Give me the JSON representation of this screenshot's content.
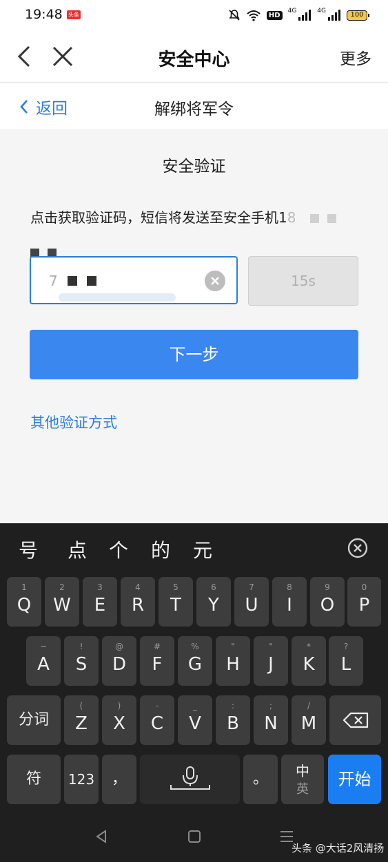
{
  "status_bar": {
    "time": "19:48",
    "app_badge": "头条",
    "hd_label": "HD",
    "network_labels": [
      "4G",
      "4G"
    ],
    "battery": "100"
  },
  "title_bar": {
    "title": "安全中心",
    "more_label": "更多"
  },
  "sub_nav": {
    "back_label": "返回",
    "title": "解绑将军令"
  },
  "verification": {
    "section_title": "安全验证",
    "instruction": "点击获取验证码，短信将发送至安全手机1",
    "instruction_suffix": "8",
    "code_value_visible": "7",
    "resend_label": "15s",
    "next_label": "下一步",
    "other_methods_label": "其他验证方式"
  },
  "keyboard": {
    "candidates": [
      "号",
      "点",
      "个",
      "的",
      "元"
    ],
    "row1": [
      {
        "hint": "1",
        "key": "Q"
      },
      {
        "hint": "2",
        "key": "W"
      },
      {
        "hint": "3",
        "key": "E"
      },
      {
        "hint": "4",
        "key": "R"
      },
      {
        "hint": "5",
        "key": "T"
      },
      {
        "hint": "6",
        "key": "Y"
      },
      {
        "hint": "7",
        "key": "U"
      },
      {
        "hint": "8",
        "key": "I"
      },
      {
        "hint": "9",
        "key": "O"
      },
      {
        "hint": "0",
        "key": "P"
      }
    ],
    "row2": [
      {
        "hint": "~",
        "key": "A"
      },
      {
        "hint": "!",
        "key": "S"
      },
      {
        "hint": "@",
        "key": "D"
      },
      {
        "hint": "#",
        "key": "F"
      },
      {
        "hint": "%",
        "key": "G"
      },
      {
        "hint": "\"",
        "key": "H"
      },
      {
        "hint": "\"",
        "key": "J"
      },
      {
        "hint": "*",
        "key": "K"
      },
      {
        "hint": "?",
        "key": "L"
      }
    ],
    "row3": [
      {
        "hint": "(",
        "key": "Z"
      },
      {
        "hint": ")",
        "key": "X"
      },
      {
        "hint": "-",
        "key": "C"
      },
      {
        "hint": "_",
        "key": "V"
      },
      {
        "hint": ":",
        "key": "B"
      },
      {
        "hint": ";",
        "key": "N"
      },
      {
        "hint": "/",
        "key": "M"
      }
    ],
    "segment_label": "分词",
    "symbol_label": "符",
    "number_label": "123",
    "comma_label": "，",
    "period_label": "。",
    "lang_top": "中",
    "lang_bottom": "英",
    "enter_label": "开始"
  },
  "watermark": "头条 @大话2风清扬",
  "colors": {
    "accent": "#3a87f0",
    "link": "#2a7de1",
    "keyboard_bg": "#1f1f1f",
    "key_bg": "#3d3d3d"
  }
}
